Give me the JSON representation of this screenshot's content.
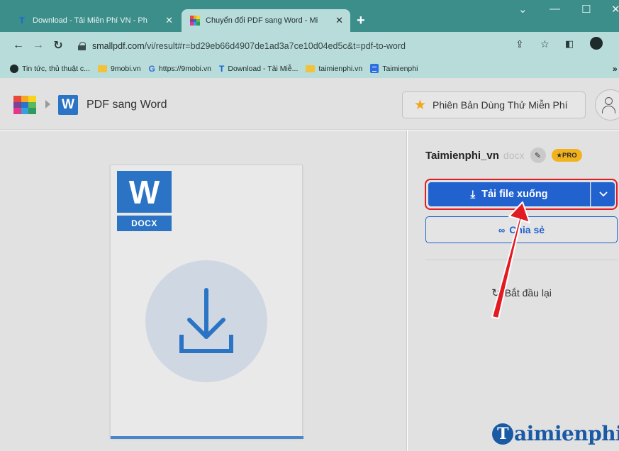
{
  "browser": {
    "tabs": [
      {
        "title": "Download - Tải Miễn Phí VN - Ph",
        "icon": "t-logo-icon",
        "active": false
      },
      {
        "title": "Chuyển đổi PDF sang Word - Mi",
        "icon": "smallpdf-icon",
        "active": true
      }
    ],
    "new_tab_label": "+",
    "window_controls": [
      "⌄",
      "—",
      "☐",
      "✕"
    ],
    "url_domain": "smallpdf.com",
    "url_path": "/vi/result#r=bd29eb66d4907de1ad3a7ce10d04ed5c&t=pdf-to-word",
    "bookmarks": [
      {
        "label": "Tin tức, thủ thuật c...",
        "icon": "globe-icon"
      },
      {
        "label": "9mobi.vn",
        "icon": "folder-icon"
      },
      {
        "label": "https://9mobi.vn",
        "icon": "google-icon"
      },
      {
        "label": "Download - Tải Miễ...",
        "icon": "t-logo-icon"
      },
      {
        "label": "taimienphi.vn",
        "icon": "folder-icon"
      },
      {
        "label": "Taimienphi",
        "icon": "doc-icon"
      }
    ]
  },
  "header": {
    "logo_colors": [
      "#e7473c",
      "#f6a623",
      "#f7d51d",
      "#7b4397",
      "#2b74c5",
      "#5cb85c",
      "#e4368f",
      "#35a0d9",
      "#2f9a5e"
    ],
    "word_badge": "W",
    "app_title": "PDF sang Word",
    "trial_button": "Phiên Bản Dùng Thử Miễn Phí"
  },
  "preview": {
    "file_type_letter": "W",
    "file_type_label": "DOCX"
  },
  "result": {
    "file_name": "Taimienphi_vn",
    "file_ext": "docx",
    "pro_badge": "★PRO",
    "download_button": "Tải file xuống",
    "share_button": "Chia sẻ",
    "restart_button": "Bắt đầu lại"
  },
  "watermark": {
    "letter": "T",
    "text": "aimienphi"
  },
  "colors": {
    "tab_bar": "#3c8e8b",
    "toolbar": "#b8dcda",
    "accent_blue": "#2162cf",
    "word_blue": "#2b74c5",
    "highlight_red": "#e21b22",
    "pro_yellow": "#f2b21c"
  }
}
